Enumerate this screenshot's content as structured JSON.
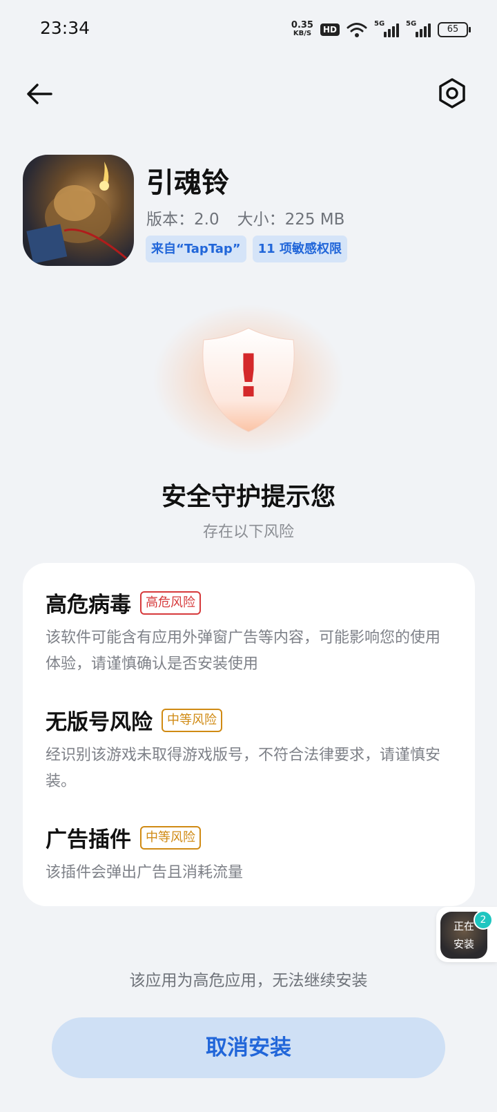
{
  "status_bar": {
    "time": "23:34",
    "net_speed_value": "0.35",
    "net_speed_unit": "KB/S",
    "hd_label": "HD",
    "signal_1_label": "5G",
    "signal_2_label": "5G",
    "battery": "65"
  },
  "topbar": {
    "back_icon": "arrow-left-icon",
    "settings_icon": "hexagon-gear-icon"
  },
  "app": {
    "name": "引魂铃",
    "version_label": "版本：",
    "version": "2.0",
    "size_label": "大小：",
    "size": "225 MB",
    "tags": [
      "来自“TapTap”",
      "11 项敏感权限"
    ]
  },
  "warning": {
    "icon": "shield-warning-icon",
    "mark": "!",
    "title": "安全守护提示您",
    "subtitle": "存在以下风险"
  },
  "risks": [
    {
      "title": "高危病毒",
      "level": "高危风险",
      "description": "该软件可能含有应用外弹窗广告等内容，可能影响您的使用体验，请谨慎确认是否安装使用"
    },
    {
      "title": "无版号风险",
      "level": "中等风险",
      "description": "经识别该游戏未取得游戏版号，不符合法律要求，请谨慎安装。"
    },
    {
      "title": "广告插件",
      "level": "中等风险",
      "description": "该插件会弹出广告且消耗流量"
    }
  ],
  "footer": {
    "note": "该应用为高危应用，无法继续安装",
    "cancel_label": "取消安装"
  },
  "floating": {
    "label_line1": "正在",
    "label_line2": "安装",
    "badge_count": "2"
  },
  "colors": {
    "accent": "#2166d9",
    "high_risk": "#d6393b",
    "mid_risk": "#d08a13",
    "background": "#f1f3f6"
  }
}
